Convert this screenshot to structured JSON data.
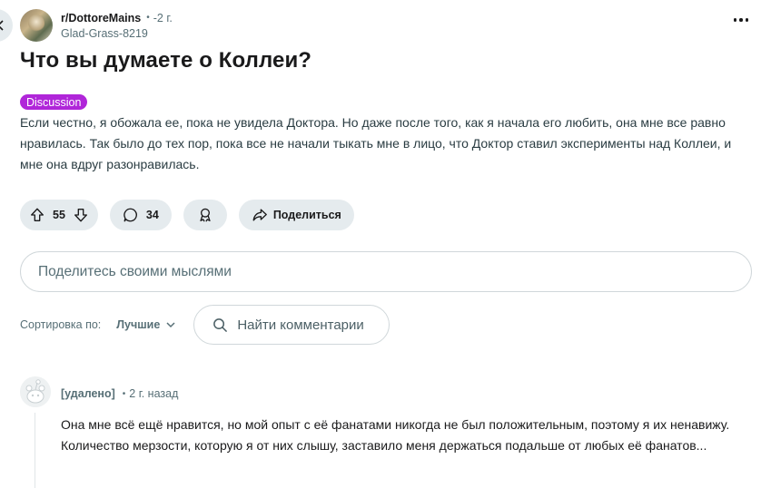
{
  "post": {
    "subreddit": "r/DottoreMains",
    "time": "2 г.",
    "author": "Glad-Grass-8219",
    "title": "Что вы думаете о Коллеи?",
    "flair": "Discussion",
    "body": "Если честно, я обожала ее, пока не увидела Доктора. Но даже после того, как я начала его любить, она мне все равно нравилась. Так было до тех пор, пока все не начали тыкать мне в лицо, что Доктор ставил эксперименты над Коллеи, и мне она вдруг разонравилась."
  },
  "actions": {
    "votes": "55",
    "comments": "34",
    "share_label": "Поделиться"
  },
  "comment_box": {
    "placeholder": "Поделитесь своими мыслями"
  },
  "sort": {
    "label": "Сортировка по:",
    "value": "Лучшие",
    "search_placeholder": "Найти комментарии"
  },
  "comments": [
    {
      "author": "[удалено]",
      "time": "2 г. назад",
      "text": "Она мне всё ещё нравится, но мой опыт с её фанатами никогда не был положительным, поэтому я их ненавижу. Количество мерзости, которую я от них слышу, заставило меня держаться подальше от любых её фанатов..."
    }
  ],
  "icons": {
    "back": "arrow-left-icon",
    "more": "more-horizontal-icon",
    "upvote": "arrow-up-icon",
    "downvote": "arrow-down-icon",
    "comment": "speech-bubble-icon",
    "award": "award-icon",
    "share": "share-arrow-icon",
    "search": "search-icon",
    "chevron": "chevron-down-icon"
  },
  "colors": {
    "flair": "#b026d9",
    "pill_bg": "#e5ebee",
    "muted_text": "#576f76"
  }
}
